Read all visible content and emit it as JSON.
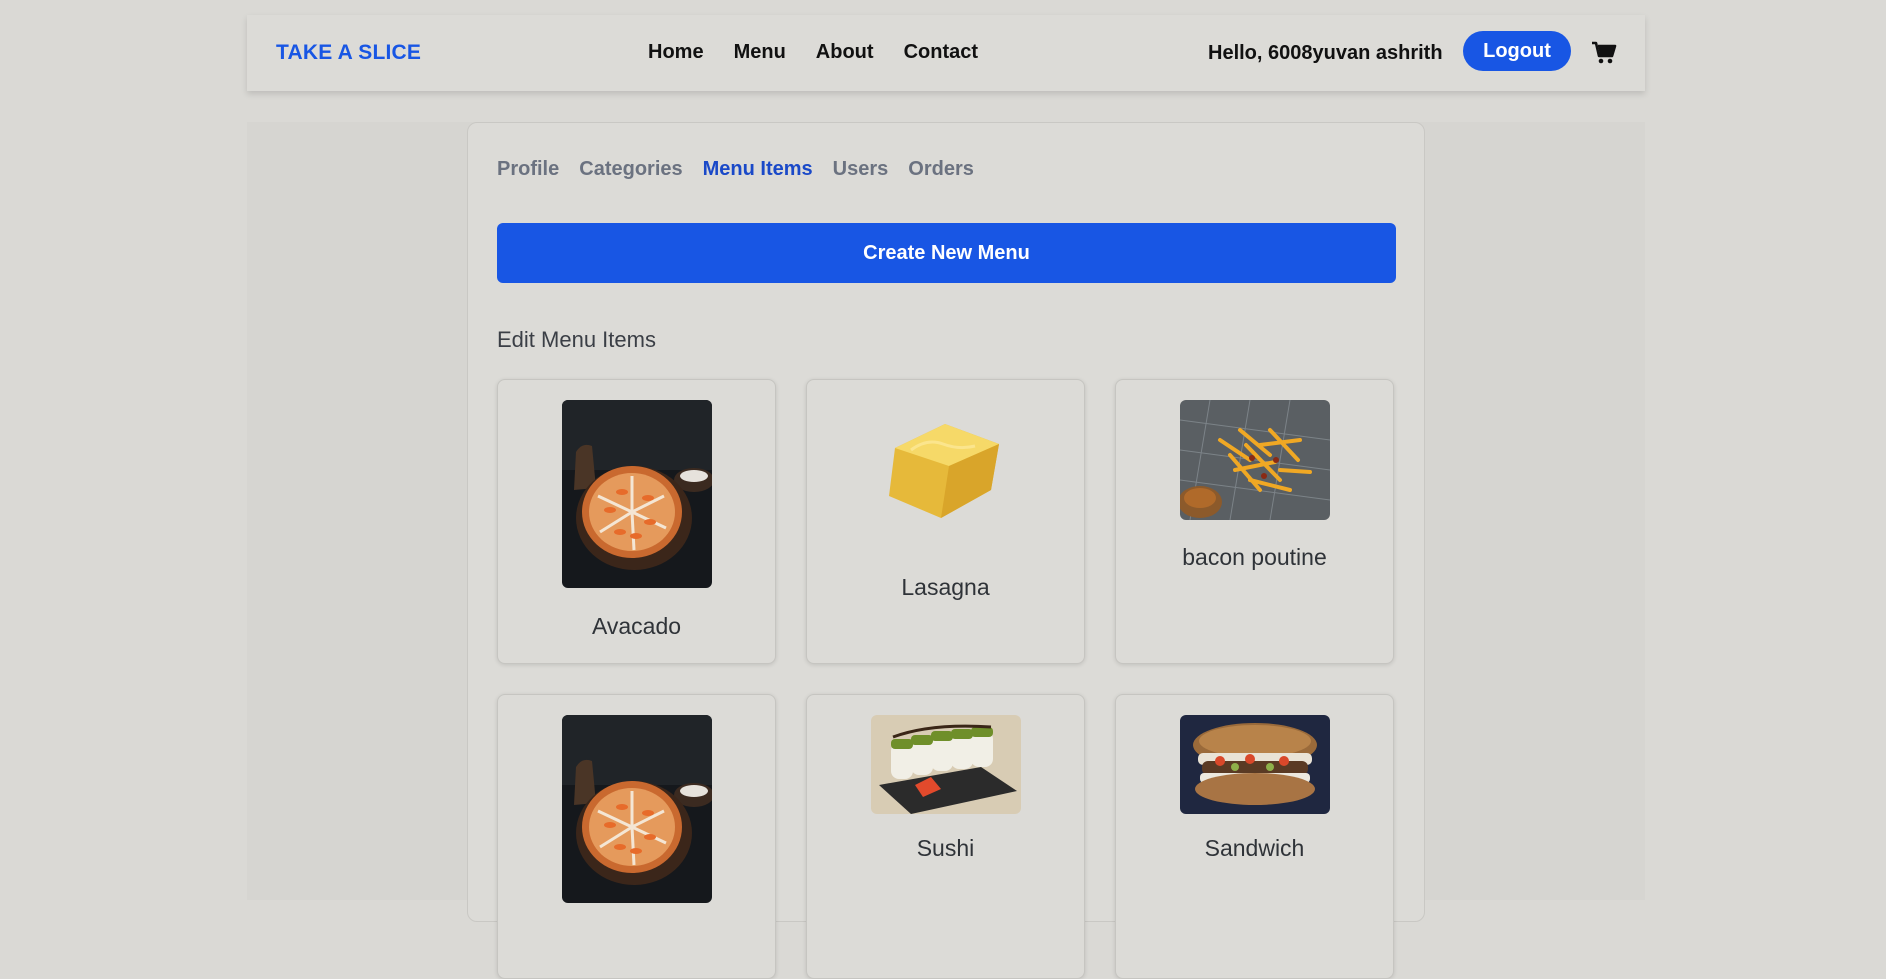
{
  "brand": "TAKE A SLICE",
  "nav": {
    "items": [
      "Home",
      "Menu",
      "About",
      "Contact"
    ]
  },
  "user": {
    "greeting": "Hello, 6008yuvan ashrith",
    "logout_label": "Logout"
  },
  "icons": {
    "cart": "cart-icon"
  },
  "colors": {
    "accent": "#1856e4",
    "active_tab": "#1a49c8",
    "inactive_tab": "#6b7280"
  },
  "admin": {
    "tabs": [
      "Profile",
      "Categories",
      "Menu Items",
      "Users",
      "Orders"
    ],
    "active_tab": "Menu Items",
    "create_label": "Create New Menu",
    "section_title": "Edit Menu Items",
    "items": [
      {
        "name": "Avacado",
        "image": "pizza-image"
      },
      {
        "name": "Lasagna",
        "image": "cheese-block-image"
      },
      {
        "name": "bacon poutine",
        "image": "fries-image"
      },
      {
        "name": "",
        "image": "pizza-image"
      },
      {
        "name": "Sushi",
        "image": "sushi-image"
      },
      {
        "name": "Sandwich",
        "image": "sandwich-image"
      }
    ]
  }
}
